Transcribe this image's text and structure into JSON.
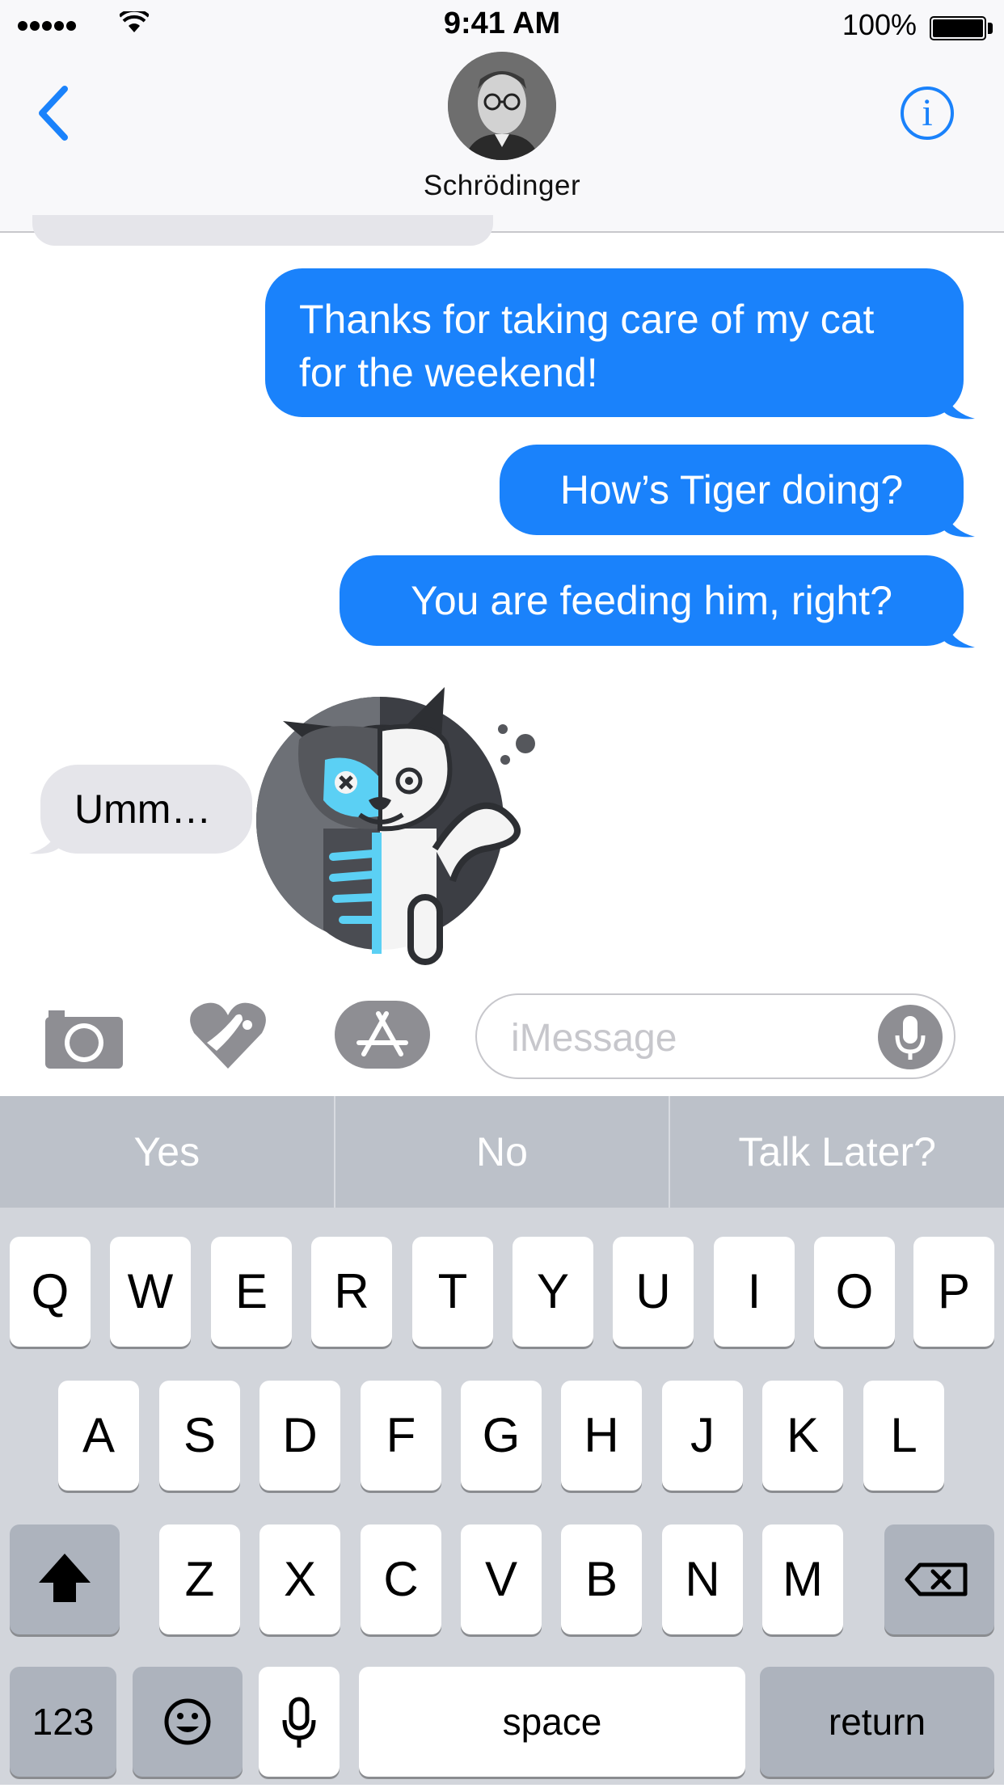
{
  "status_bar": {
    "time": "9:41 AM",
    "battery": "100%",
    "icons": [
      "signal-dots-icon",
      "wifi-icon",
      "battery-icon"
    ]
  },
  "header": {
    "contact_name": "Schrödinger",
    "back_icon": "chevron-left-icon",
    "info_label": "i",
    "accent_color": "#1a82fb"
  },
  "messages": [
    {
      "direction": "outgoing",
      "text": "Thanks for taking care of my cat for the weekend!"
    },
    {
      "direction": "outgoing",
      "text": "How’s Tiger doing?"
    },
    {
      "direction": "outgoing",
      "text": "You are feeding him, right?"
    },
    {
      "direction": "incoming",
      "text": "Umm…"
    },
    {
      "direction": "incoming",
      "type": "sticker",
      "sticker": "half-skeleton-cat-sticker"
    }
  ],
  "composer": {
    "placeholder": "iMessage",
    "icons": [
      "camera-icon",
      "digital-touch-heart-icon",
      "app-store-icon",
      "microphone-icon"
    ]
  },
  "keyboard": {
    "suggestions": [
      "Yes",
      "No",
      "Talk Later?"
    ],
    "row1": [
      "Q",
      "W",
      "E",
      "R",
      "T",
      "Y",
      "U",
      "I",
      "O",
      "P"
    ],
    "row2": [
      "A",
      "S",
      "D",
      "F",
      "G",
      "H",
      "J",
      "K",
      "L"
    ],
    "row3": [
      "Z",
      "X",
      "C",
      "V",
      "B",
      "N",
      "M"
    ],
    "numbers_label": "123",
    "space_label": "space",
    "return_label": "return",
    "special_icons": [
      "shift-icon",
      "delete-icon",
      "emoji-icon",
      "dictation-icon"
    ]
  }
}
